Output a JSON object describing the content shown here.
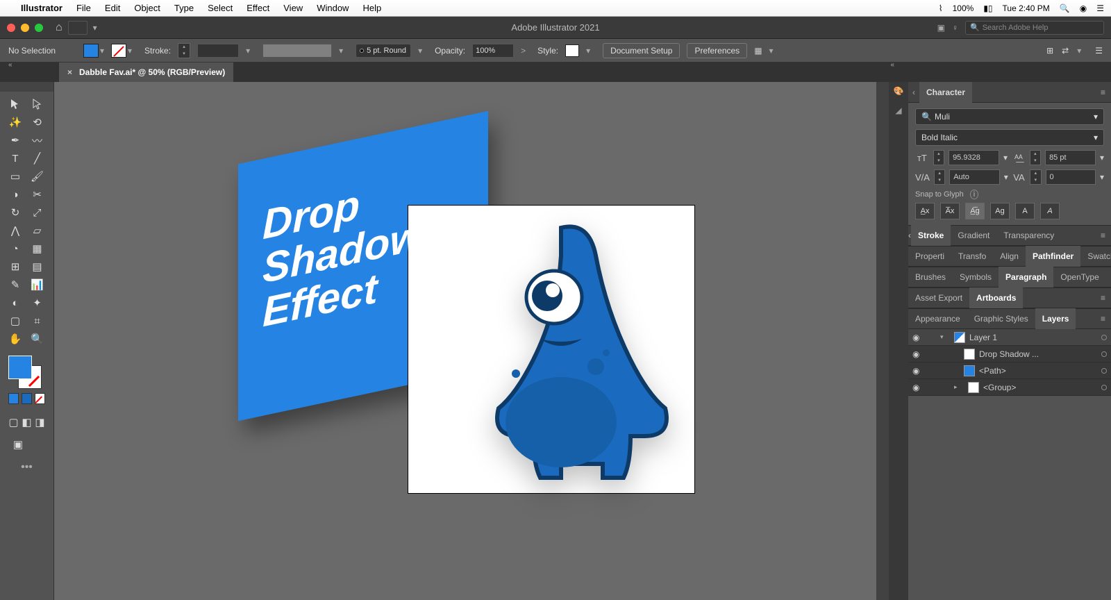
{
  "menubar": {
    "app_name": "Illustrator",
    "items": [
      "File",
      "Edit",
      "Object",
      "Type",
      "Select",
      "Effect",
      "View",
      "Window",
      "Help"
    ],
    "battery": "100%",
    "clock": "Tue 2:40 PM"
  },
  "header": {
    "title": "Adobe Illustrator 2021",
    "search_placeholder": "Search Adobe Help"
  },
  "control": {
    "selection": "No Selection",
    "stroke_label": "Stroke:",
    "brush_label": "5 pt. Round",
    "opacity_label": "Opacity:",
    "opacity_value": "100%",
    "style_label": "Style:",
    "doc_setup": "Document Setup",
    "prefs": "Preferences"
  },
  "doc_tab": "Dabble Fav.ai* @ 50% (RGB/Preview)",
  "canvas_text": {
    "l1": "Drop",
    "l2": "Shadow",
    "l3": "Effect"
  },
  "character": {
    "tab": "Character",
    "font": "Muli",
    "style": "Bold Italic",
    "size": "95.9328",
    "leading": "85 pt",
    "kerning": "Auto",
    "tracking": "0",
    "snap_label": "Snap to Glyph"
  },
  "panel_rows": {
    "r1": [
      "Stroke",
      "Gradient",
      "Transparency"
    ],
    "r2": [
      "Properti",
      "Transfo",
      "Align",
      "Pathfinder",
      "Swatch"
    ],
    "r3": [
      "Brushes",
      "Symbols",
      "Paragraph",
      "OpenType"
    ],
    "r4": [
      "Asset Export",
      "Artboards"
    ],
    "r5": [
      "Appearance",
      "Graphic Styles",
      "Layers"
    ]
  },
  "layers": [
    {
      "name": "Layer 1",
      "kind": "layer",
      "has_children": true,
      "expanded": true
    },
    {
      "name": "Drop  Shadow ...",
      "kind": "text",
      "indent": 1
    },
    {
      "name": "<Path>",
      "kind": "path",
      "indent": 1
    },
    {
      "name": "<Group>",
      "kind": "group",
      "indent": 1,
      "has_children": true
    }
  ]
}
